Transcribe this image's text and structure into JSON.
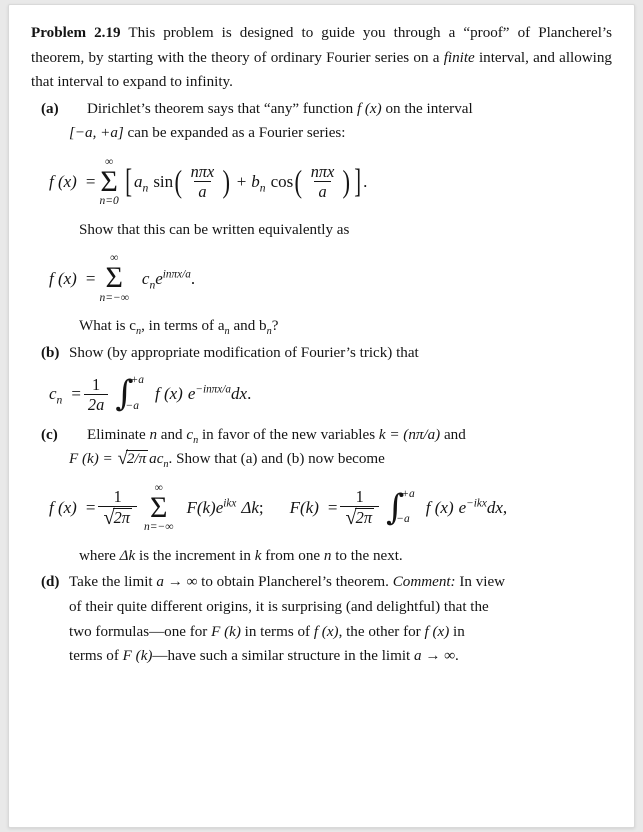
{
  "document": {
    "problem_label": "Problem 2.19",
    "intro": "This problem is designed to guide you through a “proof” of Plancherel’s theorem, by starting with the theory of ordinary Fourier series on a",
    "intro_italic": "finite",
    "intro_rest": "interval, and allowing that interval to expand to infinity."
  },
  "parts": {
    "a": {
      "label": "(a)",
      "line1": "Dirichlet’s theorem says that “any” function",
      "line1_math": "f (x)",
      "line1_end": "on the interval",
      "line2_math": "[−a, +a]",
      "line2_end": "can be expanded as a Fourier series:",
      "eq1": {
        "lhs": "f (x)",
        "equals": "=",
        "sum_top": "∞",
        "sum_bot": "n=0",
        "coef_a": "a",
        "coef_a_sub": "n",
        "sin": "sin",
        "arg_num": "nπx",
        "arg_den": "a",
        "plus": "+",
        "coef_b": "b",
        "coef_b_sub": "n",
        "cos": "cos",
        "period": "."
      },
      "midtext": "Show that this can be written equivalently as",
      "eq2": {
        "lhs": "f (x)",
        "equals": "=",
        "sum_top": "∞",
        "sum_bot": "n=−∞",
        "coef_c": "c",
        "coef_c_sub": "n",
        "exp_base": "e",
        "exp_power": "inπx/a",
        "period": "."
      },
      "question": "What is c",
      "question_sub1": "n",
      "question_mid": ", in terms of a",
      "question_sub2": "n",
      "question_and": " and b",
      "question_sub3": "n",
      "question_end": "?"
    },
    "b": {
      "label": "(b)",
      "text": "Show (by appropriate modification of Fourier’s trick) that",
      "eq": {
        "lhs": "c",
        "lhs_sub": "n",
        "equals": "=",
        "frac_num": "1",
        "frac_den": "2a",
        "int_upper": "+a",
        "int_lower": "−a",
        "integrand": "f (x)",
        "exp_base": "e",
        "exp_power": "−inπx/a",
        "dx": "dx",
        "period": "."
      }
    },
    "c": {
      "label": "(c)",
      "line1": "Eliminate",
      "line1_n": "n",
      "line1_and": "and",
      "line1_c": "c",
      "line1_c_sub": "n",
      "line1_rest": "in favor of the new variables",
      "line1_k": "k = (nπ/a)",
      "line1_end": "and",
      "line2_F": "F (k) =",
      "line2_sqrt": "2/π",
      "line2_ac": "ac",
      "line2_ac_sub": "n",
      "line2_rest": ". Show that (a) and (b) now become",
      "eq_left": {
        "lhs": "f (x)",
        "equals": "=",
        "frac_num": "1",
        "frac_den_sqrt": "2π",
        "sum_top": "∞",
        "sum_bot": "n=−∞",
        "Fk": "F(k)",
        "exp_base": "e",
        "exp_power": "ikx",
        "delta_k": "Δk",
        "semicolon": ";"
      },
      "eq_right": {
        "lhs": "F(k)",
        "equals": "=",
        "frac_num": "1",
        "frac_den_sqrt": "2π",
        "int_upper": "+a",
        "int_lower": "−a",
        "integrand": "f (x)",
        "exp_base": "e",
        "exp_power": "−ikx",
        "dx": "dx",
        "comma": ","
      },
      "closing_1": "where",
      "closing_delta": "Δk",
      "closing_2": "is the increment in",
      "closing_k": "k",
      "closing_3": "from one",
      "closing_n": "n",
      "closing_4": "to the next."
    },
    "d": {
      "label": "(d)",
      "line1_a": "Take the limit",
      "line1_math": "a → ∞",
      "line1_b": "to obtain Plancherel’s theorem.",
      "comment_label": "Comment:",
      "line1_c": "In view",
      "line2": "of their quite different origins, it is surprising (and delightful) that the",
      "line3_a": "two formulas—one for",
      "line3_Fk": "F (k)",
      "line3_b": "in terms of",
      "line3_fx": "f (x)",
      "line3_c": ", the other for",
      "line3_fx2": "f (x)",
      "line3_d": "in",
      "line4_a": "terms of",
      "line4_Fk": "F (k)",
      "line4_b": "—have such a similar structure in the limit",
      "line4_math": "a → ∞",
      "line4_end": "."
    }
  },
  "theme": {
    "page_background": "#ffffff",
    "canvas_background": "#e9e9e9",
    "text_color": "#141414",
    "border_color": "#d9d9d9"
  }
}
